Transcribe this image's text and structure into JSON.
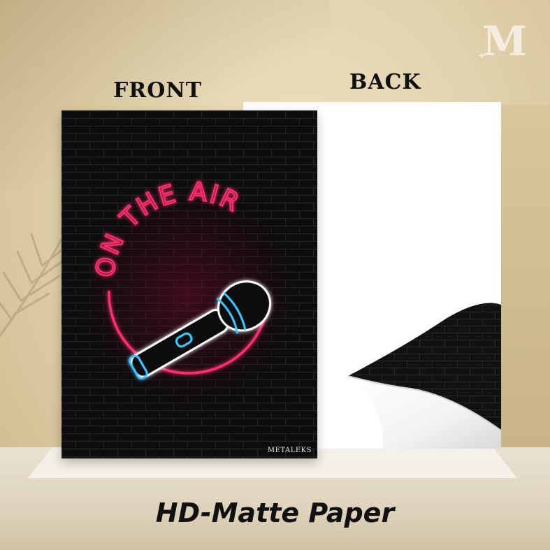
{
  "labels": {
    "front": "FRONT",
    "back": "BACK"
  },
  "logo": {
    "letter": "M",
    "spark": "✦"
  },
  "poster": {
    "neon_text": "ON THE AIR",
    "brand": "METALEKS"
  },
  "footer": {
    "title": "HD-Matte Paper"
  },
  "colors": {
    "neon_pink": "#ff2f6d",
    "neon_blue": "#38c8ff",
    "poster_bg": "#0b0b0d",
    "background": "#e2d2ad"
  }
}
